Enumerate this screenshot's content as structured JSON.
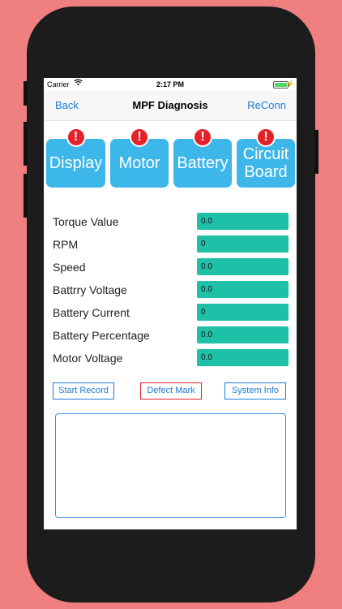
{
  "status": {
    "carrier": "Carrier",
    "time": "2:17 PM"
  },
  "nav": {
    "back": "Back",
    "title": "MPF Diagnosis",
    "reconn": "ReConn"
  },
  "tiles": [
    {
      "label": "Display",
      "alert": "!"
    },
    {
      "label": "Motor",
      "alert": "!"
    },
    {
      "label": "Battery",
      "alert": "!"
    },
    {
      "label": "Circuit Board",
      "alert": "!"
    }
  ],
  "readings": [
    {
      "label": "Torque Value",
      "value": "0.0"
    },
    {
      "label": "RPM",
      "value": "0"
    },
    {
      "label": "Speed",
      "value": "0.0"
    },
    {
      "label": "Battrry Voltage",
      "value": "0.0"
    },
    {
      "label": "Battery Current",
      "value": "0"
    },
    {
      "label": "Battery Percentage",
      "value": "0.0"
    },
    {
      "label": "Motor Voltage",
      "value": "0.0"
    }
  ],
  "buttons": {
    "start_record": "Start Record",
    "defect_mark": "Defect Mark",
    "system_info": "System Info"
  },
  "log": {
    "text": ""
  },
  "colors": {
    "background": "#f08080",
    "tile": "#3db6ea",
    "value_field": "#1fc0a8",
    "accent": "#1a7ad8",
    "alert": "#e5222a"
  }
}
